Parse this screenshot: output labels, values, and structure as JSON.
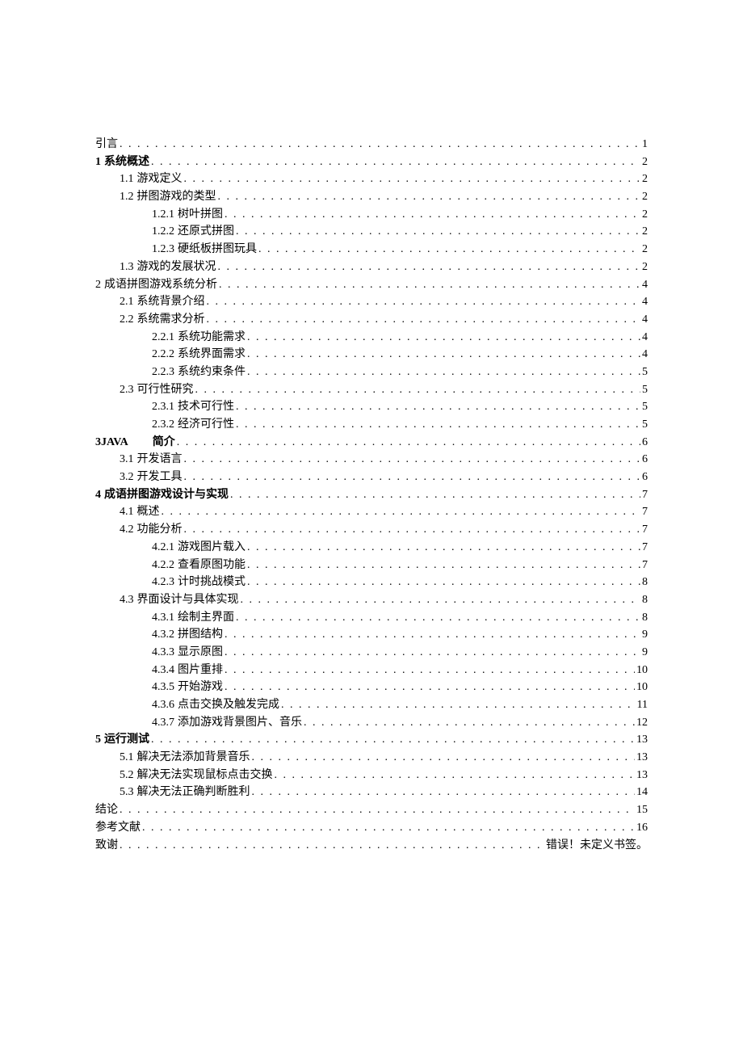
{
  "toc": [
    {
      "indent": 0,
      "bold": false,
      "num": "",
      "label": "引言",
      "page": "1"
    },
    {
      "indent": 0,
      "bold": true,
      "num": "1",
      "label": " 系统概述",
      "page": "2"
    },
    {
      "indent": 1,
      "bold": false,
      "num": "1.1",
      "label": "游戏定义",
      "page": "2"
    },
    {
      "indent": 1,
      "bold": false,
      "num": "1.2",
      "label": "拼图游戏的类型",
      "page": "2"
    },
    {
      "indent": 2,
      "bold": false,
      "num": "1.2.1",
      "label": "树叶拼图",
      "page": "2"
    },
    {
      "indent": 2,
      "bold": false,
      "num": "1.2.2",
      "label": "还原式拼图",
      "page": "2"
    },
    {
      "indent": 2,
      "bold": false,
      "num": "1.2.3",
      "label": "硬纸板拼图玩具",
      "page": "2"
    },
    {
      "indent": 1,
      "bold": false,
      "num": "1.3",
      "label": "游戏的发展状况",
      "page": "2"
    },
    {
      "indent": 0,
      "bold": false,
      "num": "2",
      "label": " 成语拼图游戏系统分析",
      "page": "4"
    },
    {
      "indent": 1,
      "bold": false,
      "num": "2.1",
      "label": "系统背景介绍",
      "page": "4"
    },
    {
      "indent": 1,
      "bold": false,
      "num": "2.2",
      "label": "系统需求分析",
      "page": "4"
    },
    {
      "indent": 2,
      "bold": false,
      "num": "2.2.1",
      "label": "系统功能需求",
      "page": "4"
    },
    {
      "indent": 2,
      "bold": false,
      "num": "2.2.2",
      "label": "系统界面需求",
      "page": "4"
    },
    {
      "indent": 2,
      "bold": false,
      "num": "2.2.3",
      "label": "系统约束条件",
      "page": "5"
    },
    {
      "indent": 1,
      "bold": false,
      "num": "2.3",
      "label": "可行性研究",
      "page": "5"
    },
    {
      "indent": 2,
      "bold": false,
      "num": "2.3.1",
      "label": "技术可行性",
      "page": "5"
    },
    {
      "indent": 2,
      "bold": false,
      "num": "2.3.2",
      "label": "经济可行性",
      "page": "5"
    },
    {
      "indent": 0,
      "bold": true,
      "num": "3JAVA",
      "label": "简介",
      "page": "6",
      "gap": true
    },
    {
      "indent": 1,
      "bold": false,
      "num": "3.1",
      "label": "开发语言",
      "page": "6"
    },
    {
      "indent": 1,
      "bold": false,
      "num": "3.2",
      "label": "开发工具",
      "page": "6"
    },
    {
      "indent": 0,
      "bold": true,
      "num": "4",
      "label": " 成语拼图游戏设计与实现",
      "page": "7"
    },
    {
      "indent": 1,
      "bold": false,
      "num": "4.1",
      "label": "概述",
      "page": "7"
    },
    {
      "indent": 1,
      "bold": false,
      "num": "4.2",
      "label": "功能分析",
      "page": "7"
    },
    {
      "indent": 2,
      "bold": false,
      "num": "4.2.1",
      "label": "游戏图片载入",
      "page": "7"
    },
    {
      "indent": 2,
      "bold": false,
      "num": "4.2.2",
      "label": "查看原图功能",
      "page": "7"
    },
    {
      "indent": 2,
      "bold": false,
      "num": "4.2.3",
      "label": "计时挑战模式",
      "page": "8"
    },
    {
      "indent": 1,
      "bold": false,
      "num": "4.3",
      "label": "界面设计与具体实现",
      "page": "8"
    },
    {
      "indent": 2,
      "bold": false,
      "num": "4.3.1",
      "label": "绘制主界面",
      "page": "8"
    },
    {
      "indent": 2,
      "bold": false,
      "num": "4.3.2",
      "label": "拼图结构",
      "page": "9"
    },
    {
      "indent": 2,
      "bold": false,
      "num": "4.3.3",
      "label": "显示原图",
      "page": "9"
    },
    {
      "indent": 2,
      "bold": false,
      "num": "4.3.4",
      "label": "图片重排",
      "page": "10"
    },
    {
      "indent": 2,
      "bold": false,
      "num": "4.3.5",
      "label": "开始游戏",
      "page": "10"
    },
    {
      "indent": 2,
      "bold": false,
      "num": "4.3.6",
      "label": "点击交换及触发完成",
      "page": "11"
    },
    {
      "indent": 2,
      "bold": false,
      "num": "4.3.7",
      "label": "添加游戏背景图片、音乐",
      "page": "12"
    },
    {
      "indent": 0,
      "bold": true,
      "num": "5",
      "label": " 运行测试",
      "page": "13"
    },
    {
      "indent": 1,
      "bold": false,
      "num": "5.1",
      "label": "解决无法添加背景音乐",
      "page": "13"
    },
    {
      "indent": 1,
      "bold": false,
      "num": "5.2",
      "label": "解决无法实现鼠标点击交换",
      "page": "13"
    },
    {
      "indent": 1,
      "bold": false,
      "num": "5.3",
      "label": "解决无法正确判断胜利",
      "page": "14"
    },
    {
      "indent": 0,
      "bold": false,
      "num": "",
      "label": "结论",
      "page": "15"
    },
    {
      "indent": 0,
      "bold": false,
      "num": "",
      "label": "参考文献",
      "page": "16"
    },
    {
      "indent": 0,
      "bold": false,
      "num": "",
      "label": "致谢",
      "page": "错误！未定义书签。"
    }
  ]
}
